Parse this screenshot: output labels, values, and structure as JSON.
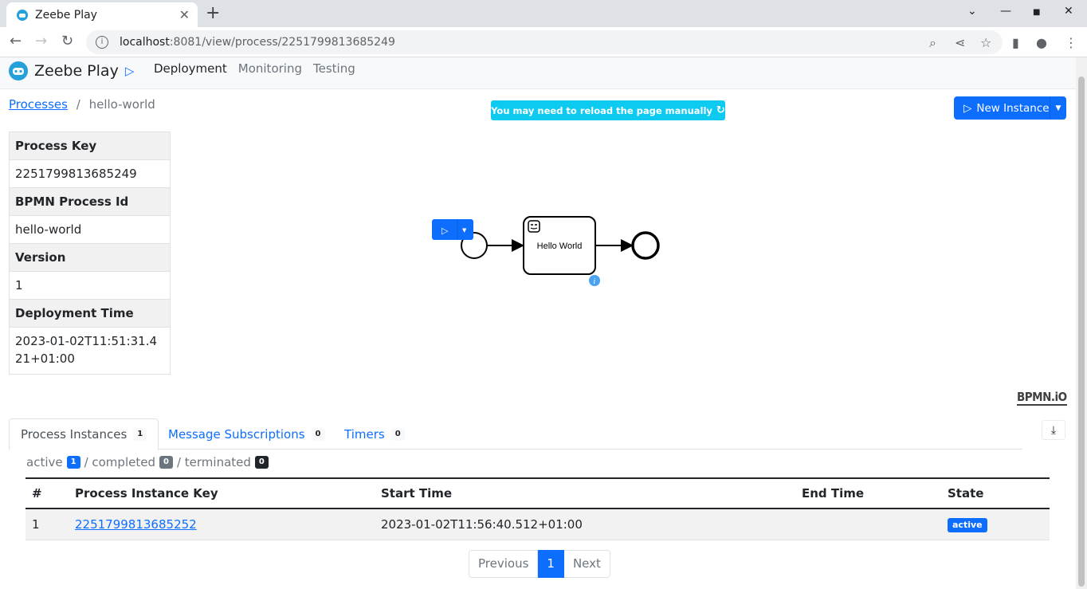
{
  "browser": {
    "tab_title": "Zeebe Play",
    "url_host": "localhost",
    "url_path": ":8081/view/process/2251799813685249"
  },
  "app": {
    "brand": "Zeebe Play",
    "nav": [
      "Deployment",
      "Monitoring",
      "Testing"
    ],
    "breadcrumb": {
      "root": "Processes",
      "separator": "/",
      "current": "hello-world"
    },
    "reload_notice": "You may need to reload the page manually",
    "new_instance_label": "New Instance",
    "properties": {
      "process_key_label": "Process Key",
      "process_key": "2251799813685249",
      "bpmn_id_label": "BPMN Process Id",
      "bpmn_id": "hello-world",
      "version_label": "Version",
      "version": "1",
      "deploy_time_label": "Deployment Time",
      "deploy_time": "2023-01-02T11:51:31.421+01:00"
    },
    "diagram": {
      "task_label": "Hello World",
      "watermark": "BPMN.iO"
    },
    "tabs": [
      {
        "label": "Process Instances",
        "count": "1"
      },
      {
        "label": "Message Subscriptions",
        "count": "0"
      },
      {
        "label": "Timers",
        "count": "0"
      }
    ],
    "stats": {
      "active_label": "active",
      "active": "1",
      "completed_label": "/ completed",
      "completed": "0",
      "terminated_label": "/ terminated",
      "terminated": "0"
    },
    "instances": {
      "headers": [
        "#",
        "Process Instance Key",
        "Start Time",
        "End Time",
        "State"
      ],
      "rows": [
        {
          "index": "1",
          "key": "2251799813685252",
          "start": "2023-01-02T11:56:40.512+01:00",
          "end": "",
          "state": "active"
        }
      ]
    },
    "pager": {
      "prev": "Previous",
      "page": "1",
      "next": "Next"
    },
    "colors": {
      "primary": "#0d6efd",
      "info": "#0dcaf0"
    }
  }
}
